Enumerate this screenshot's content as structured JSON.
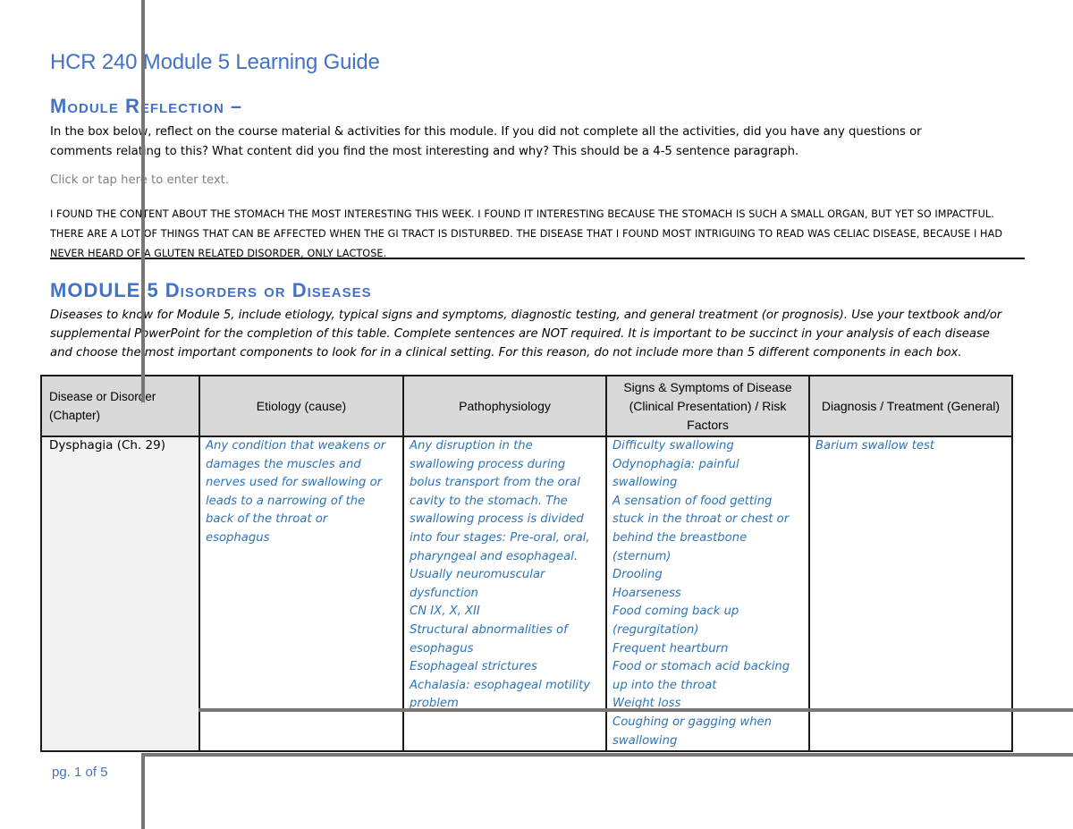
{
  "document": {
    "title": "HCR 240 Module 5 Learning Guide",
    "reflection": {
      "heading": "Module Reflection –",
      "instructions": [
        "In the box below, reflect on the course material & activities for this module.  If you did not complete all the activities, did you have any questions or",
        "comments relating to this?  What content did you find the most interesting and why?  This should be a 4-5 sentence paragraph."
      ],
      "placeholder": "Click or tap here to enter text.",
      "answer_lines": [
        "I found the content about the stomach the most interesting this week. I found it interesting because the stomach is such a small organ, but yet so impactful.",
        "There are a lot of things that can be affected when the GI tract is disturbed. The disease that I found most intriguing to read was celiac disease, because I had",
        "never heard of a gluten related disorder, only lactose."
      ]
    },
    "disorders": {
      "heading": "MODULE 5 Disorders or Diseases",
      "intro_lines": [
        "Diseases to know for Module 5, include etiology, typical signs and symptoms, diagnostic testing, and general treatment (or prognosis).  Use your textbook and/or",
        "supplemental PowerPoint for the completion of this table.  Complete sentences are NOT required.   It is important to be succinct in your analysis of each disease",
        "and choose the most important components to look for in a clinical setting. For this reason, do not include more than 5 different components in each box."
      ],
      "table": {
        "headers": [
          "Disease or Disorder (Chapter)",
          "Etiology (cause)",
          "Pathophysiology",
          "Signs & Symptoms of Disease (Clinical Presentation) / Risk Factors",
          "Diagnosis / Treatment (General)"
        ],
        "rows": [
          {
            "disease": "Dysphagia (Ch. 29)",
            "etiology": [
              "Any condition that weakens or",
              "damages the muscles and",
              "nerves used for swallowing or",
              "leads to a narrowing of the",
              "back of the throat or",
              "esophagus"
            ],
            "pathophysiology": [
              "Any disruption in the",
              "swallowing process during",
              "bolus transport from the oral",
              "cavity to the stomach. The",
              "swallowing process is divided",
              "into four stages: Pre-oral, oral,",
              "pharyngeal and esophageal.",
              "Usually neuromuscular",
              "dysfunction",
              "CN IX, X, XII",
              "Structural abnormalities of",
              "esophagus",
              "Esophageal strictures",
              "Achalasia: esophageal motility",
              "problem"
            ],
            "signs_symptoms": [
              "Difficulty swallowing",
              "Odynophagia: painful",
              "swallowing",
              "A sensation of food getting",
              "stuck in the throat or chest or",
              "behind the breastbone",
              "(sternum)",
              "Drooling",
              "Hoarseness",
              "Food coming back up",
              "(regurgitation)",
              "Frequent heartburn",
              "Food or stomach acid backing",
              "up into the throat",
              "Weight loss",
              "Coughing or gagging when",
              "swallowing"
            ],
            "diagnosis_treatment": [
              "Barium swallow test"
            ]
          }
        ]
      }
    },
    "footer": {
      "page_label": "pg. 1 of 5"
    }
  },
  "colors": {
    "heading_blue": "#4472c4",
    "answer_blue": "#2e74b5",
    "placeholder_gray": "#808080",
    "header_fill": "#d9d9d9",
    "first_col_fill": "#f2f2f2"
  }
}
